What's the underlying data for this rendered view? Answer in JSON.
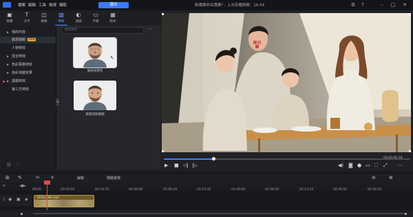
{
  "menu": {
    "items": [
      "檔案",
      "編輯",
      "工具",
      "檢視",
      "擷取"
    ],
    "export_label": "匯出"
  },
  "window": {
    "title": "新專案命名專案* - 上次存檔時間：16:54"
  },
  "toolbar": {
    "items": [
      {
        "label": "媒體",
        "icon": "media-icon"
      },
      {
        "label": "文字",
        "icon": "text-icon"
      },
      {
        "label": "轉場",
        "icon": "transition-icon"
      },
      {
        "label": "特效",
        "icon": "effects-icon",
        "active": true
      },
      {
        "label": "濾鏡",
        "icon": "filter-icon"
      },
      {
        "label": "字幕",
        "icon": "subtitle-icon"
      },
      {
        "label": "範本",
        "icon": "template-icon"
      }
    ]
  },
  "sidebar": {
    "items": [
      {
        "label": "我的內容",
        "arrow": true
      },
      {
        "label": "臉部濾鏡",
        "badge": "NEW",
        "selected": true
      },
      {
        "label": "人物特效"
      },
      {
        "label": "混合特效",
        "arrow": true
      },
      {
        "label": "色彩風格特效",
        "arrow": true
      },
      {
        "label": "色彩漸變效果",
        "arrow": true
      },
      {
        "label": "基礎特效",
        "arrow": true,
        "marked": true
      },
      {
        "label": "第三方特效"
      }
    ]
  },
  "effects": {
    "search_placeholder": "搜尋特效",
    "items": [
      {
        "label": "臉部馬賽克"
      },
      {
        "label": "臉部高斯模糊"
      }
    ]
  },
  "player": {
    "current_time": "00:00:06:18",
    "progress": 0.2
  },
  "timeline": {
    "edit_label": "編輯",
    "frames_label": "關鍵畫格",
    "ruler": [
      "00:00",
      "00:16:20",
      "00:33:10",
      "00:50:00",
      "01:06:20",
      "01:23:10",
      "01:40:00",
      "01:56:20",
      "02:13:10",
      "02:30:00",
      "02:46:20"
    ],
    "clip_label": "1920x1080.mp4"
  }
}
